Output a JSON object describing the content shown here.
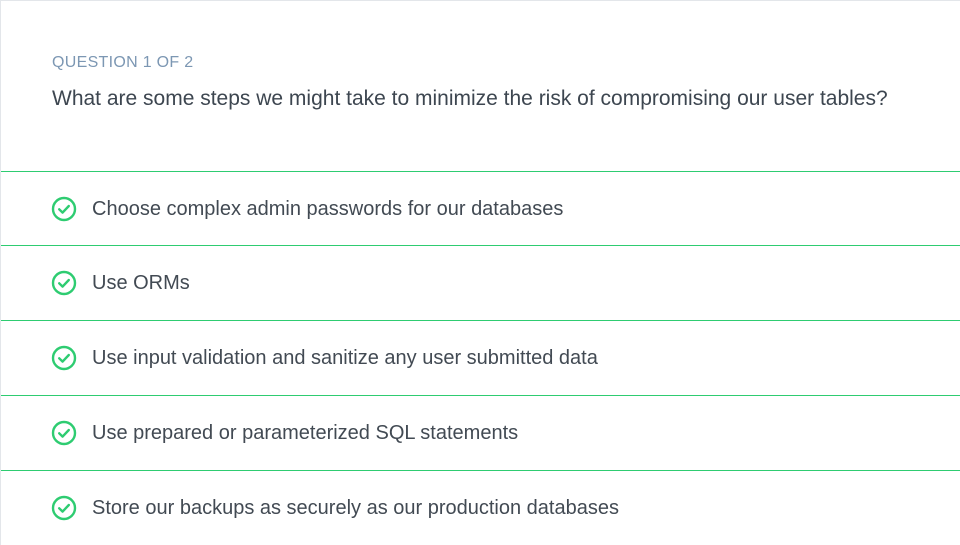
{
  "quiz": {
    "counter": "QUESTION 1 OF 2",
    "question": "What are some steps we might take to minimize the risk of compromising our user tables?",
    "accent_color": "#2ecc71",
    "answers": [
      {
        "label": "Choose complex admin passwords for our databases",
        "icon": "check-circle-icon",
        "selected": true
      },
      {
        "label": "Use ORMs",
        "icon": "check-circle-icon",
        "selected": true
      },
      {
        "label": "Use input validation and sanitize any user submitted data",
        "icon": "check-circle-icon",
        "selected": true
      },
      {
        "label": "Use prepared or parameterized SQL statements",
        "icon": "check-circle-icon",
        "selected": true
      },
      {
        "label": "Store our backups as securely as our production databases",
        "icon": "check-circle-icon",
        "selected": true
      }
    ]
  }
}
